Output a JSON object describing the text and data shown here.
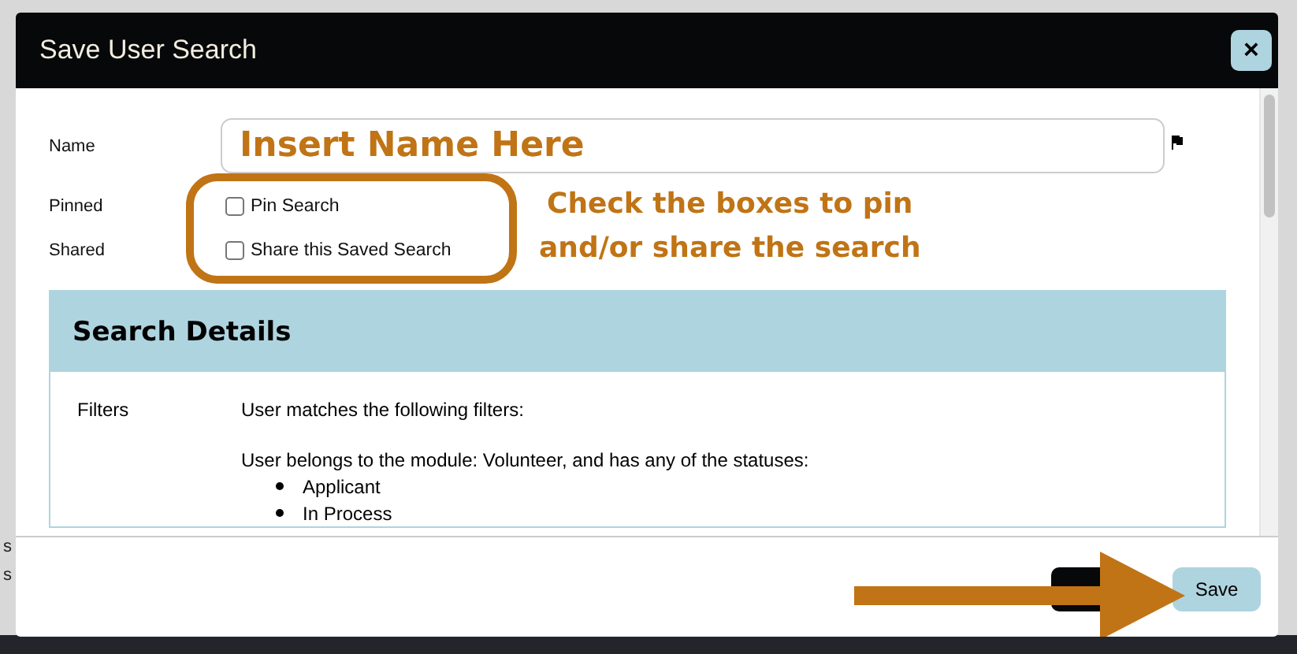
{
  "background": {
    "texts": [
      "s",
      "s"
    ]
  },
  "dialog": {
    "title": "Save User Search",
    "close_label": "×"
  },
  "form": {
    "name_label": "Name",
    "name_value": "Insert Name Here",
    "rows": [
      {
        "label": "Pinned",
        "option": "Pin Search",
        "checked": false
      },
      {
        "label": "Shared",
        "option": "Share this Saved Search",
        "checked": false
      }
    ]
  },
  "annotation": {
    "lines": [
      "Check the boxes to pin",
      "and/or share the search"
    ]
  },
  "details": {
    "title": "Search Details",
    "filters_label": "Filters",
    "intro": "User matches the following filters:",
    "module_text": "User belongs to the module: Volunteer, and has any of the statuses:",
    "statuses": [
      "Applicant",
      "In Process"
    ]
  },
  "footer": {
    "save": "Save"
  }
}
